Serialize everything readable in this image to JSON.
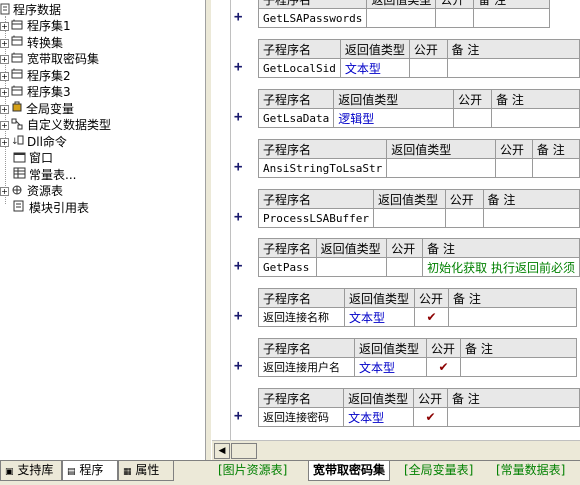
{
  "tree": {
    "root": "程序数据",
    "items": [
      {
        "label": "程序集1",
        "icon": "module-icon",
        "expander": "+"
      },
      {
        "label": "转换集",
        "icon": "module-icon",
        "expander": "+"
      },
      {
        "label": "宽带取密码集",
        "icon": "module-icon",
        "expander": "+"
      },
      {
        "label": "程序集2",
        "icon": "module-icon",
        "expander": "+"
      },
      {
        "label": "程序集3",
        "icon": "module-icon",
        "expander": "+"
      },
      {
        "label": "全局变量",
        "icon": "global-variable-icon",
        "expander": "+"
      },
      {
        "label": "自定义数据类型",
        "icon": "data-type-icon",
        "expander": "+"
      },
      {
        "label": "Dll命令",
        "icon": "dll-command-icon",
        "expander": "+"
      },
      {
        "label": "窗口",
        "icon": "window-icon",
        "expander": ""
      },
      {
        "label": "常量表...",
        "icon": "constant-table-icon",
        "expander": ""
      },
      {
        "label": "资源表",
        "icon": "resource-table-icon",
        "expander": "+"
      },
      {
        "label": "模块引用表",
        "icon": "module-reference-icon",
        "expander": ""
      }
    ]
  },
  "left_tabs": {
    "support_library": "支持库",
    "program": "程序",
    "properties": "属性"
  },
  "headers": {
    "name": "子程序名",
    "return_type": "返回值类型",
    "public": "公开",
    "remark": "备 注"
  },
  "plus_symbol": "+",
  "public_check": "✔",
  "subroutines": [
    {
      "name": "GetLSAPasswords",
      "return_type": "",
      "public": false,
      "remark": "",
      "header_partial": true
    },
    {
      "name": "GetLocalSid",
      "return_type": "文本型",
      "public": false,
      "remark": ""
    },
    {
      "name": "GetLsaData",
      "return_type": "逻辑型",
      "public": false,
      "remark": ""
    },
    {
      "name": "AnsiStringToLsaStr",
      "return_type": "",
      "public": false,
      "remark": ""
    },
    {
      "name": "ProcessLSABuffer",
      "return_type": "",
      "public": false,
      "remark": ""
    },
    {
      "name": "GetPass",
      "return_type": "",
      "public": false,
      "remark": "初始化获取 执行返回前必须"
    },
    {
      "name": "返回连接名称",
      "return_type": "文本型",
      "public": true,
      "remark": ""
    },
    {
      "name": "返回连接用户名",
      "return_type": "文本型",
      "public": true,
      "remark": ""
    },
    {
      "name": "返回连接密码",
      "return_type": "文本型",
      "public": true,
      "remark": ""
    }
  ],
  "sheet_tabs": [
    {
      "label": "[图片资源表]",
      "active": false
    },
    {
      "label": "宽带取密码集",
      "active": true
    },
    {
      "label": "[全局变量表]",
      "active": false
    },
    {
      "label": "[常量数据表]",
      "active": false
    }
  ],
  "colors": {
    "type_text": "#0000c8",
    "remark_text": "#008000",
    "check": "#8b0000",
    "header_bg": "#e8e8e8"
  }
}
